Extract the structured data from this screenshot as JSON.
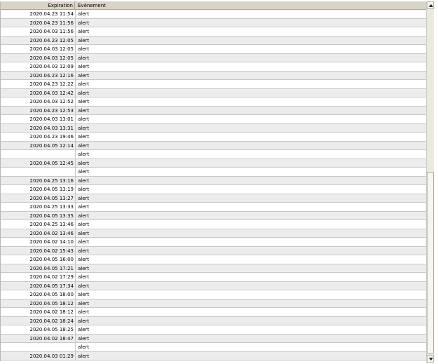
{
  "table": {
    "headers": {
      "expiration": "Expiration",
      "event": "Evénement"
    },
    "rows": [
      {
        "expiration": "2020.04.23 11:54",
        "event": "alert"
      },
      {
        "expiration": "2020.04.23 11:56",
        "event": "alert"
      },
      {
        "expiration": "2020.04.03 11:56",
        "event": "alert"
      },
      {
        "expiration": "2020.04.23 12:05",
        "event": "alert"
      },
      {
        "expiration": "2020.04.03 12:05",
        "event": "alert"
      },
      {
        "expiration": "2020.04.03 12:05",
        "event": "alert"
      },
      {
        "expiration": "2020.04.03 12:09",
        "event": "alert"
      },
      {
        "expiration": "2020.04.23 12:16",
        "event": "alert"
      },
      {
        "expiration": "2020.04.23 12:22",
        "event": "alert"
      },
      {
        "expiration": "2020.04.03 12:42",
        "event": "alert"
      },
      {
        "expiration": "2020.04.03 12:52",
        "event": "alert"
      },
      {
        "expiration": "2020.04.23 12:53",
        "event": "alert"
      },
      {
        "expiration": "2020.04.03 13:01",
        "event": "alert"
      },
      {
        "expiration": "2020.04.03 13:31",
        "event": "alert"
      },
      {
        "expiration": "2020.04.23 19:46",
        "event": "alert"
      },
      {
        "expiration": "2020.04.05 12:14",
        "event": "alert"
      },
      {
        "expiration": "",
        "event": "alert"
      },
      {
        "expiration": "2020.04.05 12:45",
        "event": "alert"
      },
      {
        "expiration": "",
        "event": "alert"
      },
      {
        "expiration": "2020.04.25 13:16",
        "event": "alert"
      },
      {
        "expiration": "2020.04.05 13:19",
        "event": "alert"
      },
      {
        "expiration": "2020.04.05 13:27",
        "event": "alert"
      },
      {
        "expiration": "2020.04.25 13:33",
        "event": "alert"
      },
      {
        "expiration": "2020.04.05 13:35",
        "event": "alert"
      },
      {
        "expiration": "2020.04.25 13:46",
        "event": "alert"
      },
      {
        "expiration": "2020.04.02 13:46",
        "event": "alert"
      },
      {
        "expiration": "2020.04.02 14:10",
        "event": "alert"
      },
      {
        "expiration": "2020.04.02 15:43",
        "event": "alert"
      },
      {
        "expiration": "2020.04.05 16:00",
        "event": "alert"
      },
      {
        "expiration": "2020.04.05 17:21",
        "event": "alert"
      },
      {
        "expiration": "2020.04.02 17:29",
        "event": "alert"
      },
      {
        "expiration": "2020.04.05 17:34",
        "event": "alert"
      },
      {
        "expiration": "2020.04.05 18:00",
        "event": "alert"
      },
      {
        "expiration": "2020.04.05 18:12",
        "event": "alert"
      },
      {
        "expiration": "2020.04.02 18:12",
        "event": "alert"
      },
      {
        "expiration": "2020.04.02 18:24",
        "event": "alert"
      },
      {
        "expiration": "2020.04.05 18:25",
        "event": "alert"
      },
      {
        "expiration": "2020.04.02 18:47",
        "event": "alert"
      },
      {
        "expiration": "",
        "event": "alert"
      },
      {
        "expiration": "2020.04.03 01:29",
        "event": "alert"
      }
    ]
  },
  "scrollbar": {
    "up_icon": "arrow-up-icon",
    "down_icon": "arrow-down-icon"
  }
}
